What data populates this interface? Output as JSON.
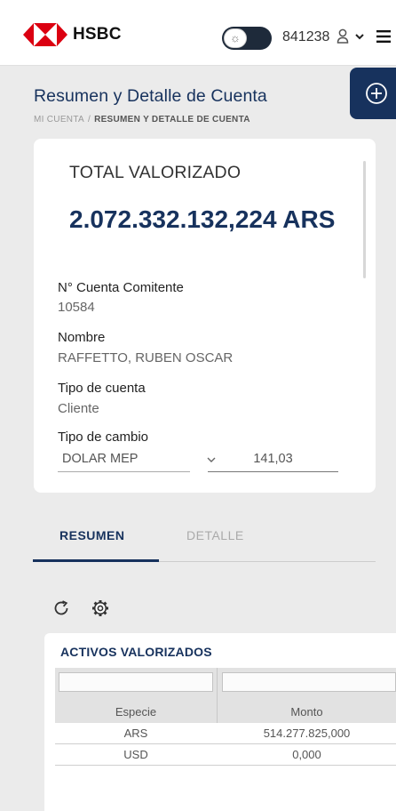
{
  "header": {
    "brand": "HSBC",
    "user_id": "841238",
    "brand_colors": {
      "red": "#db0011",
      "navy": "#17325d"
    }
  },
  "page": {
    "title": "Resumen y Detalle de Cuenta",
    "breadcrumb": [
      "MI CUENTA",
      "RESUMEN Y DETALLE DE CUENTA"
    ],
    "breadcrumb_separator": "/"
  },
  "summary": {
    "total_label": "TOTAL VALORIZADO",
    "total_value": "2.072.332.132,224 ARS",
    "fields": [
      {
        "label": "N° Cuenta Comitente",
        "value": "10584"
      },
      {
        "label": "Nombre",
        "value": "RAFFETTO, RUBEN OSCAR"
      },
      {
        "label": "Tipo de cuenta",
        "value": "Cliente"
      },
      {
        "label": "Tipo de cambio",
        "value": ""
      }
    ],
    "exchange_select": "DOLAR MEP",
    "exchange_rate": "141,03"
  },
  "tabs": [
    {
      "label": "RESUMEN",
      "active": true
    },
    {
      "label": "DETALLE",
      "active": false
    }
  ],
  "assets": {
    "title": "ACTIVOS VALORIZADOS",
    "columns": [
      "Especie",
      "Monto"
    ],
    "rows": [
      [
        "ARS",
        "514.277.825,000"
      ],
      [
        "USD",
        "0,000"
      ]
    ]
  },
  "icons": [
    "sun-icon",
    "user-icon",
    "chevron-down-icon",
    "menu-icon",
    "add-circle-icon",
    "refresh-icon",
    "gear-icon"
  ]
}
